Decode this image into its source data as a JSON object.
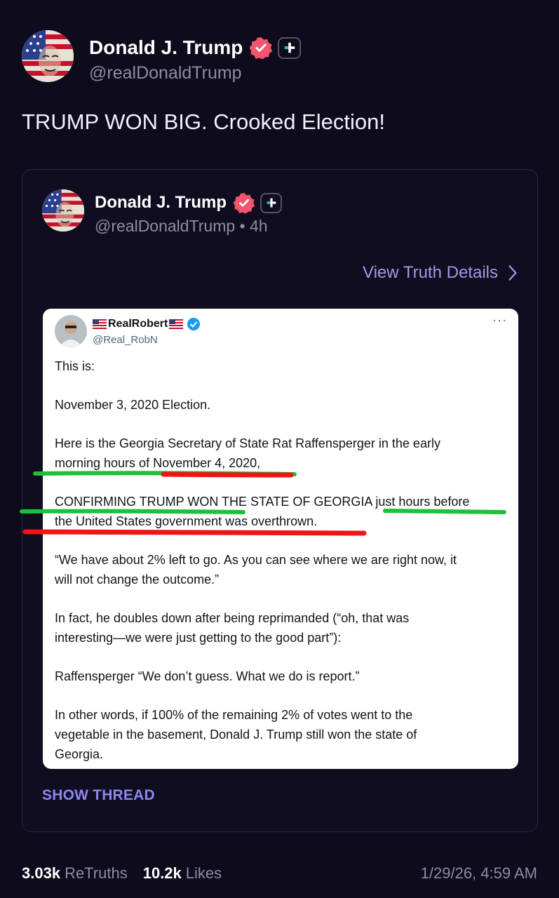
{
  "post": {
    "author": {
      "display_name": "Donald J. Trump",
      "handle": "@realDonaldTrump"
    },
    "text": "TRUMP WON BIG. Crooked Election!",
    "footer": {
      "retruths_count": "3.03k",
      "retruths_label": "ReTruths",
      "likes_count": "10.2k",
      "likes_label": "Likes",
      "timestamp": "1/29/26, 4:59 AM"
    }
  },
  "quoted": {
    "author": {
      "display_name": "Donald J. Trump",
      "handle_time": "@realDonaldTrump • 4h"
    },
    "view_details_label": "View Truth Details",
    "show_thread_label": "SHOW THREAD",
    "tweet": {
      "name": "RealRobert",
      "handle": "@Real_RobN",
      "more": "···",
      "p1": "This is:",
      "p2": "November 3, 2020 Election.",
      "p3a": "Here is the Georgia Secretary of State Rat Raffensperger in the early",
      "p3b": "morning hours of November 4, 2020,",
      "p4a": "CONFIRMING TRUMP WON THE STATE OF GEORGIA just hours before",
      "p4b": "the United States government was overthrown.",
      "p5a": "“We have about 2% left to go. As you can see where we are right now, it",
      "p5b": "will not change the outcome.”",
      "p6a": "In fact, he doubles down after being reprimanded (“oh, that was",
      "p6b": "interesting—we were just getting to the good part”):",
      "p7": "Raffensperger “We don’t guess. What we do is report.”",
      "p8a": "In other words, if 100% of the remaining 2% of votes went to the",
      "p8b": "vegetable in the basement, Donald J. Trump still won the state of",
      "p8c": "Georgia."
    }
  },
  "colors": {
    "background": "#0d0b1c",
    "accent": "#a09ae8",
    "verified_badge": "#f2556c",
    "underline_green": "#1dbf3b",
    "underline_red": "#f01414"
  },
  "icons": [
    "verified-badge-icon",
    "plus-badge-icon",
    "chevron-right-icon",
    "more-icon",
    "x-verified-icon",
    "us-flag-icon"
  ]
}
